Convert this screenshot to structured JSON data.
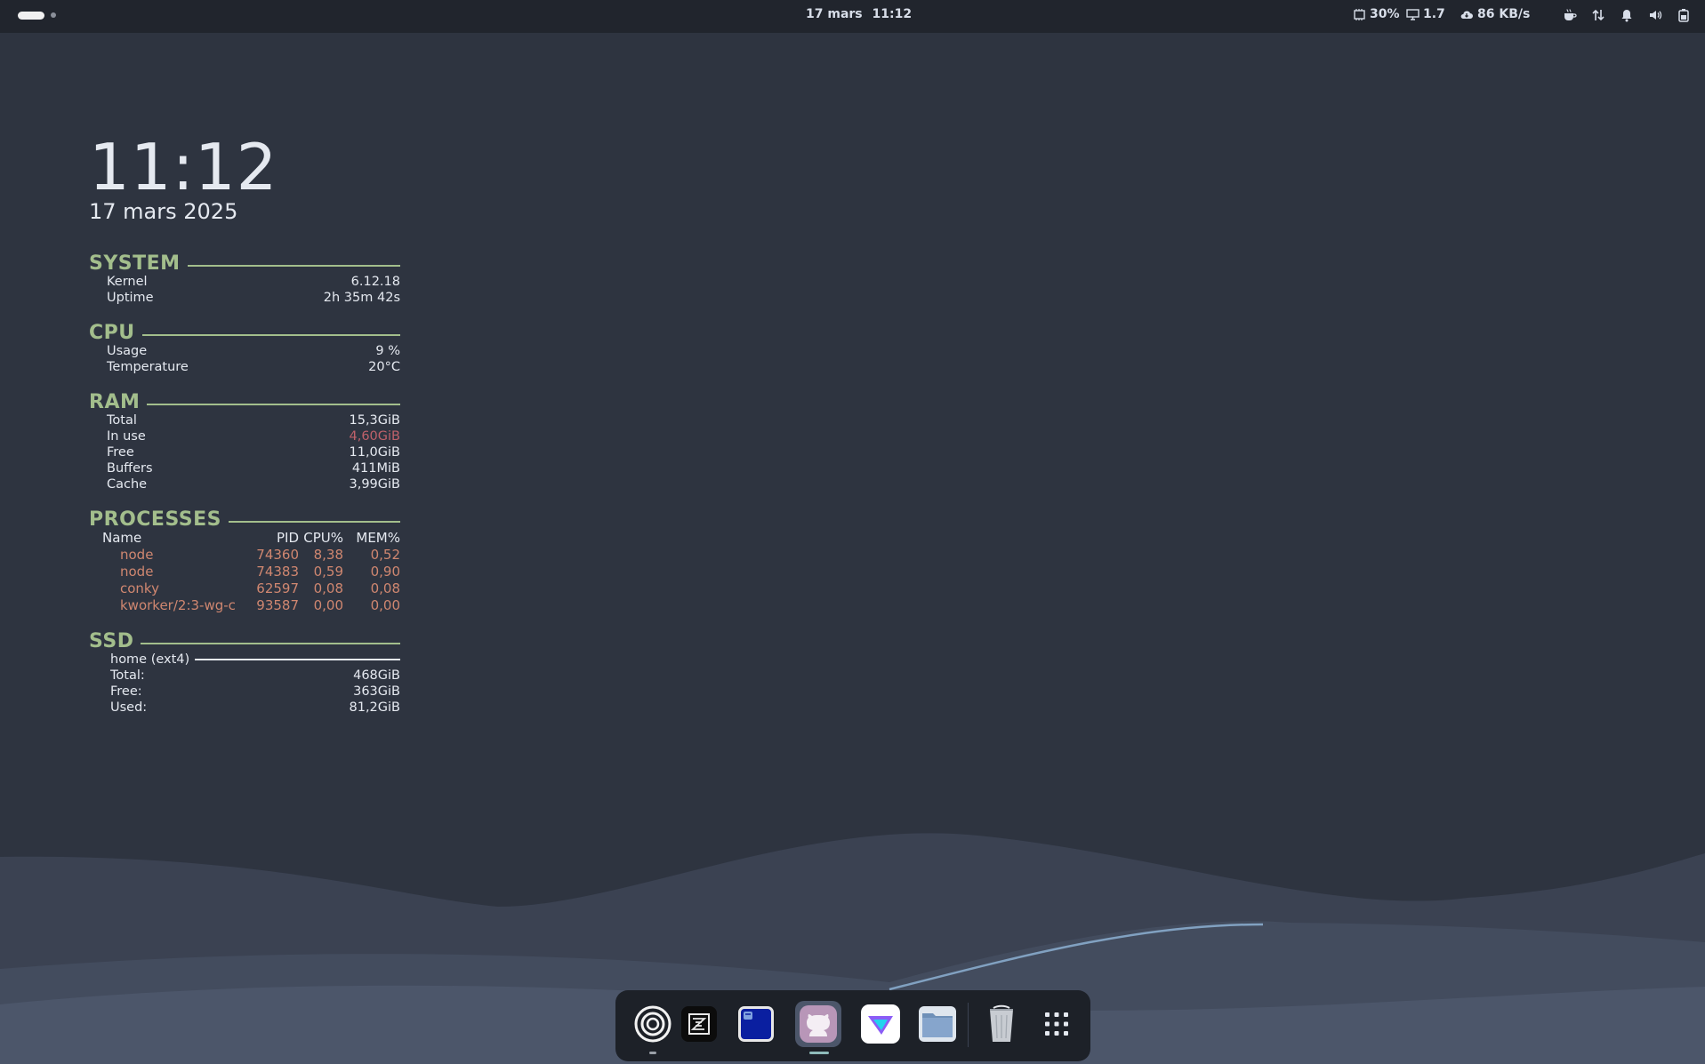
{
  "topbar": {
    "date": "17 mars",
    "time": "11:12",
    "cpu": "30%",
    "load": "1.7",
    "net": "86 KB/s",
    "icons": [
      "workspace-indicator",
      "cpu-chip-icon",
      "monitor-icon",
      "cloud-download-icon",
      "coffee-icon",
      "network-arrows-icon",
      "notification-bell-icon",
      "volume-icon",
      "battery-icon"
    ]
  },
  "conky": {
    "clock": "11:12",
    "date": "17 mars 2025",
    "system": {
      "title": "SYSTEM",
      "rows": [
        {
          "label": "Kernel",
          "value": "6.12.18"
        },
        {
          "label": "Uptime",
          "value": "2h 35m 42s"
        }
      ]
    },
    "cpu": {
      "title": "CPU",
      "rows": [
        {
          "label": "Usage",
          "value": "9 %"
        },
        {
          "label": "Temperature",
          "value": "20°C"
        }
      ]
    },
    "ram": {
      "title": "RAM",
      "rows": [
        {
          "label": "Total",
          "value": "15,3GiB"
        },
        {
          "label": "In use",
          "value": "4,60GiB"
        },
        {
          "label": "Free",
          "value": "11,0GiB"
        },
        {
          "label": "Buffers",
          "value": "411MiB"
        },
        {
          "label": "Cache",
          "value": "3,99GiB"
        }
      ]
    },
    "processes": {
      "title": "PROCESSES",
      "headers": [
        "Name",
        "PID",
        "CPU%",
        "MEM%"
      ],
      "rows": [
        {
          "name": "node",
          "pid": "74360",
          "cpu": "8,38",
          "mem": "0,52"
        },
        {
          "name": "node",
          "pid": "74383",
          "cpu": "0,59",
          "mem": "0,90"
        },
        {
          "name": "conky",
          "pid": "62597",
          "cpu": "0,08",
          "mem": "0,08"
        },
        {
          "name": "kworker/2:3-wg-c",
          "pid": "93587",
          "cpu": "0,00",
          "mem": "0,00"
        }
      ]
    },
    "ssd": {
      "title": "SSD",
      "mount": "home (ext4)",
      "rows": [
        {
          "label": "Total:",
          "value": "468GiB"
        },
        {
          "label": "Free:",
          "value": "363GiB"
        },
        {
          "label": "Used:",
          "value": "81,2GiB"
        }
      ]
    }
  },
  "colors": {
    "accent_green": "#a3be8c",
    "warn_red": "#bf616a",
    "process_orange": "#d08770",
    "background": "#2e3440"
  },
  "dock": {
    "apps": [
      "rings-app-icon",
      "zed-editor-icon",
      "terminal-app-icon",
      "github-desktop-icon",
      "proton-vpn-icon",
      "files-icon",
      "trash-icon",
      "app-grid-icon"
    ]
  }
}
